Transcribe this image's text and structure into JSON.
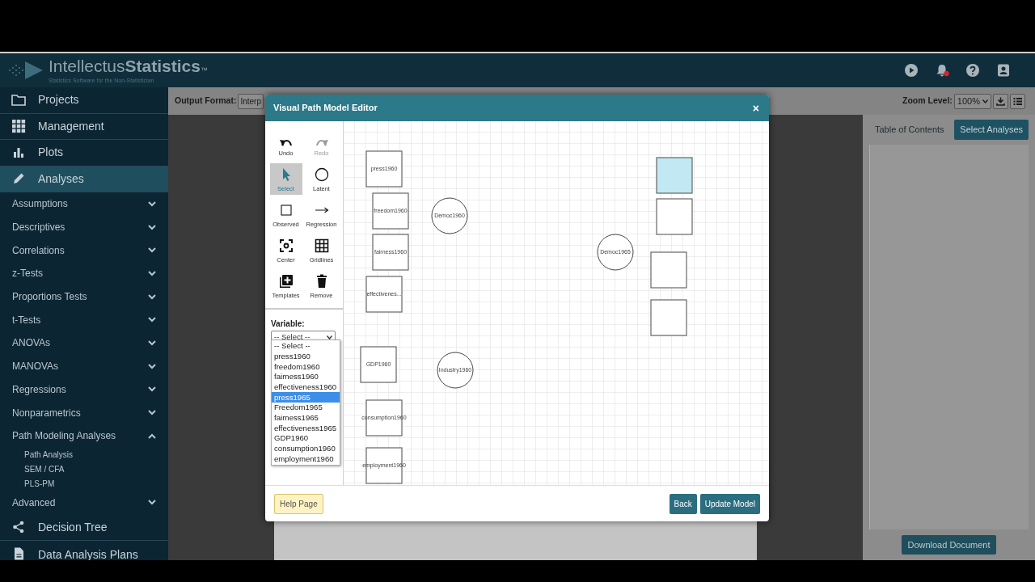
{
  "header": {
    "brand": "Intellectus**Statistics**",
    "trademark": "™",
    "tagline": "Statistics Software for the Non-Statistician"
  },
  "sidebar": {
    "items": [
      {
        "label": "Projects",
        "selected": false
      },
      {
        "label": "Management",
        "selected": false
      },
      {
        "label": "Plots",
        "selected": false
      },
      {
        "label": "Analyses",
        "selected": true,
        "children": [
          {
            "label": "Assumptions",
            "expanded": false
          },
          {
            "label": "Descriptives",
            "expanded": false
          },
          {
            "label": "Correlations",
            "expanded": false
          },
          {
            "label": "z-Tests",
            "expanded": false
          },
          {
            "label": "Proportions Tests",
            "expanded": false
          },
          {
            "label": "t-Tests",
            "expanded": false
          },
          {
            "label": "ANOVAs",
            "expanded": false
          },
          {
            "label": "MANOVAs",
            "expanded": false
          },
          {
            "label": "Regressions",
            "expanded": false
          },
          {
            "label": "Nonparametrics",
            "expanded": false
          },
          {
            "label": "Path Modeling Analyses",
            "expanded": true,
            "children": [
              {
                "label": "Path Analysis"
              },
              {
                "label": "SEM / CFA"
              },
              {
                "label": "PLS-PM"
              }
            ]
          },
          {
            "label": "Advanced",
            "expanded": false
          }
        ]
      },
      {
        "label": "Decision Tree",
        "selected": false
      },
      {
        "label": "Data Analysis Plans",
        "selected": false
      }
    ]
  },
  "toolbar": {
    "output_format_label": "Output Format:",
    "output_format_value": "Interp",
    "zoom_label": "Zoom Level:",
    "zoom_value": "100%"
  },
  "right_panel": {
    "tabs": [
      {
        "label": "Table of Contents",
        "selected": false
      },
      {
        "label": "Select Analyses",
        "selected": true
      }
    ],
    "download_button": "Download Document"
  },
  "editor": {
    "title": "Visual Path Model Editor",
    "close": "×",
    "tools": [
      {
        "label": "Undo",
        "selected": false,
        "disabled": false
      },
      {
        "label": "Redo",
        "selected": false,
        "disabled": true
      },
      {
        "label": "Select",
        "selected": true,
        "disabled": false
      },
      {
        "label": "Latent",
        "selected": false,
        "disabled": false
      },
      {
        "label": "Observed",
        "selected": false,
        "disabled": false
      },
      {
        "label": "Regression",
        "selected": false,
        "disabled": false
      },
      {
        "label": "Center",
        "selected": false,
        "disabled": false
      },
      {
        "label": "Gridlines",
        "selected": false,
        "disabled": false
      },
      {
        "label": "Templates",
        "selected": false,
        "disabled": false
      },
      {
        "label": "Remove",
        "selected": false,
        "disabled": false
      }
    ],
    "variable_label": "Variable:",
    "variable_value": "-- Select --",
    "options": [
      {
        "label": "-- Select --",
        "selected": false
      },
      {
        "label": "press1960",
        "selected": false
      },
      {
        "label": "freedom1960",
        "selected": false
      },
      {
        "label": "fairness1960",
        "selected": false
      },
      {
        "label": "effectiveness1960",
        "selected": false
      },
      {
        "label": "press1965",
        "selected": true
      },
      {
        "label": "Freedom1965",
        "selected": false
      },
      {
        "label": "fairness1965",
        "selected": false
      },
      {
        "label": "effectiveness1965",
        "selected": false
      },
      {
        "label": "GDP1960",
        "selected": false
      },
      {
        "label": "consumption1960",
        "selected": false
      },
      {
        "label": "employment1960",
        "selected": false
      }
    ],
    "nodes": [
      {
        "kind": "observed",
        "label": "press1960",
        "highlighted": false
      },
      {
        "kind": "observed",
        "label": "freedom1960",
        "highlighted": false
      },
      {
        "kind": "observed",
        "label": "fairness1960",
        "highlighted": false
      },
      {
        "kind": "observed",
        "label": "effectivenes...",
        "highlighted": false
      },
      {
        "kind": "observed",
        "label": "GDP1960",
        "highlighted": false
      },
      {
        "kind": "observed",
        "label": "consumption1960",
        "highlighted": false
      },
      {
        "kind": "observed",
        "label": "employment1960",
        "highlighted": false
      },
      {
        "kind": "latent",
        "label": "Democ1960",
        "highlighted": false
      },
      {
        "kind": "latent",
        "label": "Industry1960",
        "highlighted": false
      },
      {
        "kind": "latent",
        "label": "Democ1965",
        "highlighted": false
      },
      {
        "kind": "observed",
        "highlighted": true
      },
      {
        "kind": "observed",
        "highlighted": false
      },
      {
        "kind": "observed",
        "highlighted": false
      },
      {
        "kind": "observed",
        "highlighted": false
      }
    ],
    "help_button": "Help Page",
    "back_button": "Back",
    "update_button": "Update Model"
  }
}
